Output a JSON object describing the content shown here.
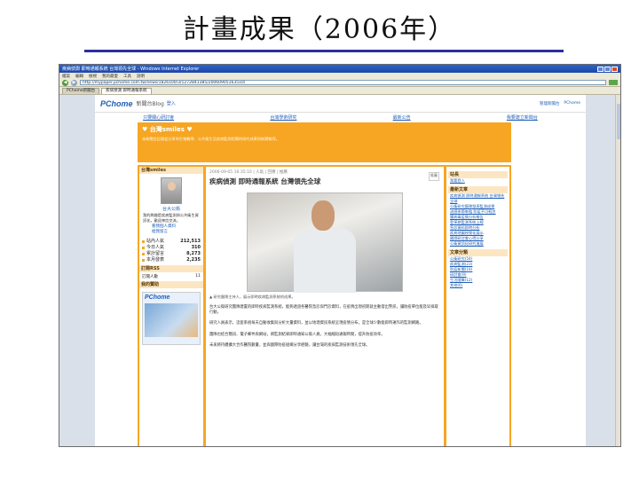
{
  "slide": {
    "title": "計畫成果（2006年）"
  },
  "browser": {
    "window_title": "疾病偵測 即時通報系統 台灣領先全球 - Windows Internet Explorer",
    "menu": [
      "檔案",
      "編輯",
      "檢視",
      "我的最愛",
      "工具",
      "說明"
    ],
    "url": "http://mypaper.pchome.com.tw/news/1826100/3/1272841385/20060905163510/",
    "tabs": [
      "PChome新聞台",
      "疾病偵測 即時通報系統"
    ]
  },
  "site": {
    "logo": "PChome",
    "logo_sub": "新聞台Blog",
    "login": "登入",
    "header_links": [
      "管理新聞台",
      "PChome"
    ],
    "toplinks": [
      "只要關心研討會",
      "台灣學術研究",
      "最新公告",
      "我要建立新聞台"
    ]
  },
  "banner": {
    "title": "♥ 台灣smiles ♥",
    "text": "本新聞台記錄並分享與生物醫學、公共衛生及疾病監測相關的研究成果與新聞報導。"
  },
  "left": {
    "profile_head": "台灣smiles",
    "author": "台大公衛",
    "bio": "我的興趣是疾病監測與公共衛生資訊化，歡迎來信交流。",
    "links": [
      "看我個人資料",
      "給我留言"
    ],
    "stats": [
      {
        "label": "站內人氣",
        "value": "212,513"
      },
      {
        "label": "今日人氣",
        "value": "310"
      },
      {
        "label": "累計留言",
        "value": "8,273"
      },
      {
        "label": "本月發表",
        "value": "2,235"
      }
    ],
    "rss_head": "訂閱RSS",
    "rss_label": "訂閱人數",
    "rss_value": "11",
    "ad_head": "我的贊助",
    "ad_logo": "PChome"
  },
  "post": {
    "meta": "2006-09-05 16:35:10 | 人氣 | 回應 | 推薦",
    "title": "疾病偵測 即時通報系統 台灣領先全球",
    "push": "推薦",
    "caption": "▲ 研究團隊主持人，展示即時疾病監測系統的成果。",
    "paragraphs": [
      "台大公衛研究團隊建置的即時疾病監測系統，能夠透過各醫院急診與門診資料，在疫情出現初期就主動發出警訊，讓防疫單位能及早採取行動。",
      "研究人員表示，這套系統每天自動收集與分析大量資料，並以地理資訊系統呈現疫情分布，是全球少數能即時運作的監測網路。",
      "團隊也結合簡訊、電子郵件與網站，將監測結果即時通知公衛人員，大幅縮短通報時間，提升防疫效率。",
      "未來將持續擴大合作醫院數量，並與國際防疫組織分享經驗，讓台灣的疾病監測技術領先全球。"
    ]
  },
  "right": {
    "sec1_head": "站長",
    "sec1_items": [
      "我要登入"
    ],
    "sec2_head": "最新文章",
    "sec2_items": [
      "疾病偵測 即時通報系統 台灣領先全球",
      "公衛研究團隊發表監測成果",
      "流感季節來臨 防疫不可輕忽",
      "腸病毒疫情分析報告",
      "登革熱監測系統上線",
      "急診資料即時分析",
      "疾病地圖視覺化展示",
      "國際研討會心得分享",
      "公衛資訊化研究進展"
    ],
    "sec3_head": "文章分類",
    "sec3_items": [
      "公衛研究(54)",
      "疾病監測(23)",
      "防疫新聞(18)",
      "研討會(9)",
      "生活隨筆(12)",
      "其他(6)"
    ]
  }
}
